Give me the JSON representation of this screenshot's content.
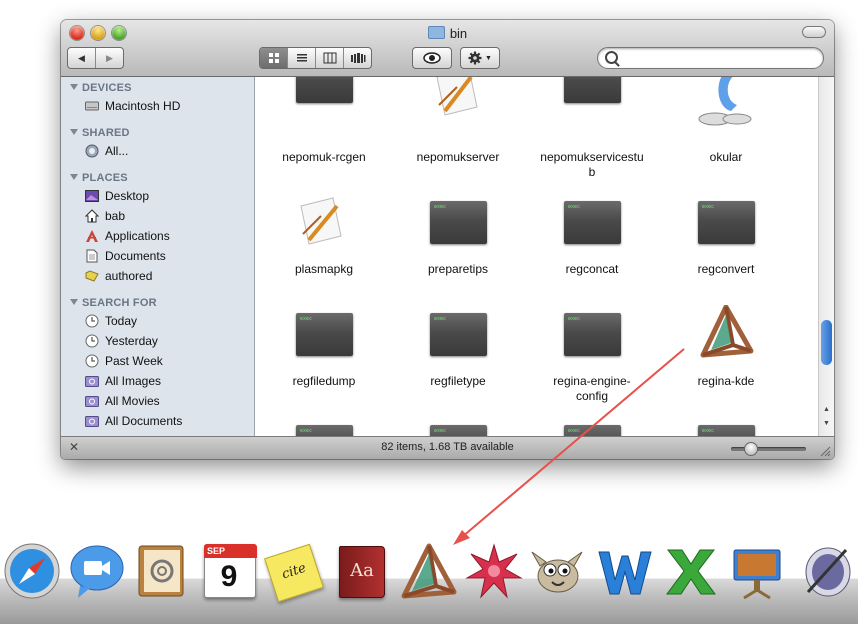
{
  "window": {
    "title": "bin",
    "status_text": "82 items, 1.68 TB available"
  },
  "toolbar": {
    "back_icon": "◀",
    "forward_icon": "▶",
    "view_icons": [
      "icon-view-icon",
      "list-view-icon",
      "column-view-icon",
      "coverflow-view-icon"
    ],
    "quicklook_icon": "eye-icon",
    "action_icon": "gear-icon",
    "search_placeholder": ""
  },
  "sidebar": {
    "sections": [
      {
        "heading": "DEVICES",
        "items": [
          {
            "label": "Macintosh HD",
            "icon": "hard-disk-icon"
          }
        ]
      },
      {
        "heading": "SHARED",
        "items": [
          {
            "label": "All...",
            "icon": "network-icon"
          }
        ]
      },
      {
        "heading": "PLACES",
        "items": [
          {
            "label": "Desktop",
            "icon": "desktop-icon"
          },
          {
            "label": "bab",
            "icon": "home-icon"
          },
          {
            "label": "Applications",
            "icon": "applications-icon"
          },
          {
            "label": "Documents",
            "icon": "documents-icon"
          },
          {
            "label": "authored",
            "icon": "folder-icon"
          }
        ]
      },
      {
        "heading": "SEARCH FOR",
        "items": [
          {
            "label": "Today",
            "icon": "clock-icon"
          },
          {
            "label": "Yesterday",
            "icon": "clock-icon"
          },
          {
            "label": "Past Week",
            "icon": "clock-icon"
          },
          {
            "label": "All Images",
            "icon": "smart-folder-icon"
          },
          {
            "label": "All Movies",
            "icon": "smart-folder-icon"
          },
          {
            "label": "All Documents",
            "icon": "smart-folder-icon"
          }
        ]
      }
    ]
  },
  "files": [
    {
      "name_line1": "nepomuk-rcgen",
      "name_line2": "",
      "icon": "exec-icon"
    },
    {
      "name_line1": "nepomukserver",
      "name_line2": "",
      "icon": "script-app-icon"
    },
    {
      "name_line1": "nepomukservicestu",
      "name_line2": "b",
      "icon": "exec-icon"
    },
    {
      "name_line1": "okular",
      "name_line2": "",
      "icon": "okular-icon"
    },
    {
      "name_line1": "plasmapkg",
      "name_line2": "",
      "icon": "script-app-icon"
    },
    {
      "name_line1": "preparetips",
      "name_line2": "",
      "icon": "exec-icon"
    },
    {
      "name_line1": "regconcat",
      "name_line2": "",
      "icon": "exec-icon"
    },
    {
      "name_line1": "regconvert",
      "name_line2": "",
      "icon": "exec-icon"
    },
    {
      "name_line1": "regfiledump",
      "name_line2": "",
      "icon": "exec-icon"
    },
    {
      "name_line1": "regfiletype",
      "name_line2": "",
      "icon": "exec-icon"
    },
    {
      "name_line1": "regina-engine-",
      "name_line2": "config",
      "icon": "exec-icon"
    },
    {
      "name_line1": "regina-kde",
      "name_line2": "",
      "icon": "regina-icon"
    }
  ],
  "exec_label": "exec",
  "dock": {
    "icons": [
      "safari-icon",
      "ichat-icon",
      "address-book-icon",
      "ical-icon",
      "citeulike-icon",
      "dictionary-icon",
      "regina-icon",
      "mathematica-icon",
      "gimp-icon",
      "word-icon",
      "excel-icon",
      "keynote-icon",
      "preview-icon"
    ],
    "ical_month": "SEP",
    "ical_day": "9",
    "dictionary_text": "Aa",
    "cite_text": "cite"
  },
  "colors": {
    "arrow": "#e8504a",
    "sidebar_bg": "#dde4ec",
    "scroll_thumb": "#2a6fcf"
  }
}
